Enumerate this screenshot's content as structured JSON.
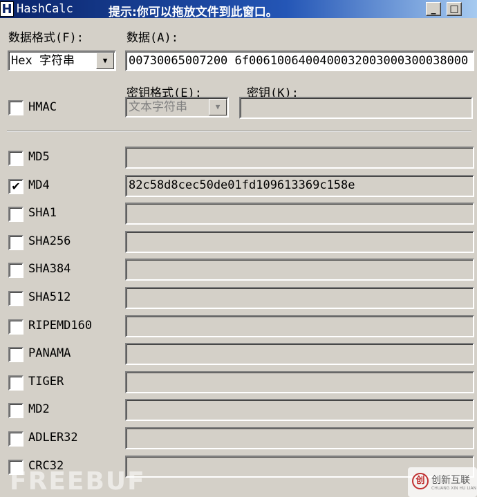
{
  "window": {
    "app_icon_letter": "H",
    "title": "HashCalc",
    "hint": "提示:你可以拖放文件到此窗口。",
    "minimize": "_",
    "maximize": "□",
    "close": "×"
  },
  "data_format": {
    "label": "数据格式(F):",
    "value": "Hex 字符串"
  },
  "data": {
    "label": "数据(A):",
    "value": "00730065007200 6f0061006400400032003000300038000"
  },
  "hmac": {
    "label": "HMAC",
    "checked": false,
    "key_format_label": "密钥格式(E):",
    "key_format_value": "文本字符串",
    "key_label": "密钥(K):",
    "key_value": ""
  },
  "hashes": [
    {
      "name": "MD5",
      "checked": false,
      "value": ""
    },
    {
      "name": "MD4",
      "checked": true,
      "value": "82c58d8cec50de01fd109613369c158e"
    },
    {
      "name": "SHA1",
      "checked": false,
      "value": ""
    },
    {
      "name": "SHA256",
      "checked": false,
      "value": ""
    },
    {
      "name": "SHA384",
      "checked": false,
      "value": ""
    },
    {
      "name": "SHA512",
      "checked": false,
      "value": ""
    },
    {
      "name": "RIPEMD160",
      "checked": false,
      "value": ""
    },
    {
      "name": "PANAMA",
      "checked": false,
      "value": ""
    },
    {
      "name": "TIGER",
      "checked": false,
      "value": ""
    },
    {
      "name": "MD2",
      "checked": false,
      "value": ""
    },
    {
      "name": "ADLER32",
      "checked": false,
      "value": ""
    },
    {
      "name": "CRC32",
      "checked": false,
      "value": ""
    }
  ],
  "watermark": {
    "left": "FREEBUF",
    "right_logo": "创",
    "right_text": "创新互联",
    "right_sub": "CHUANG XIN HU LIAN"
  }
}
